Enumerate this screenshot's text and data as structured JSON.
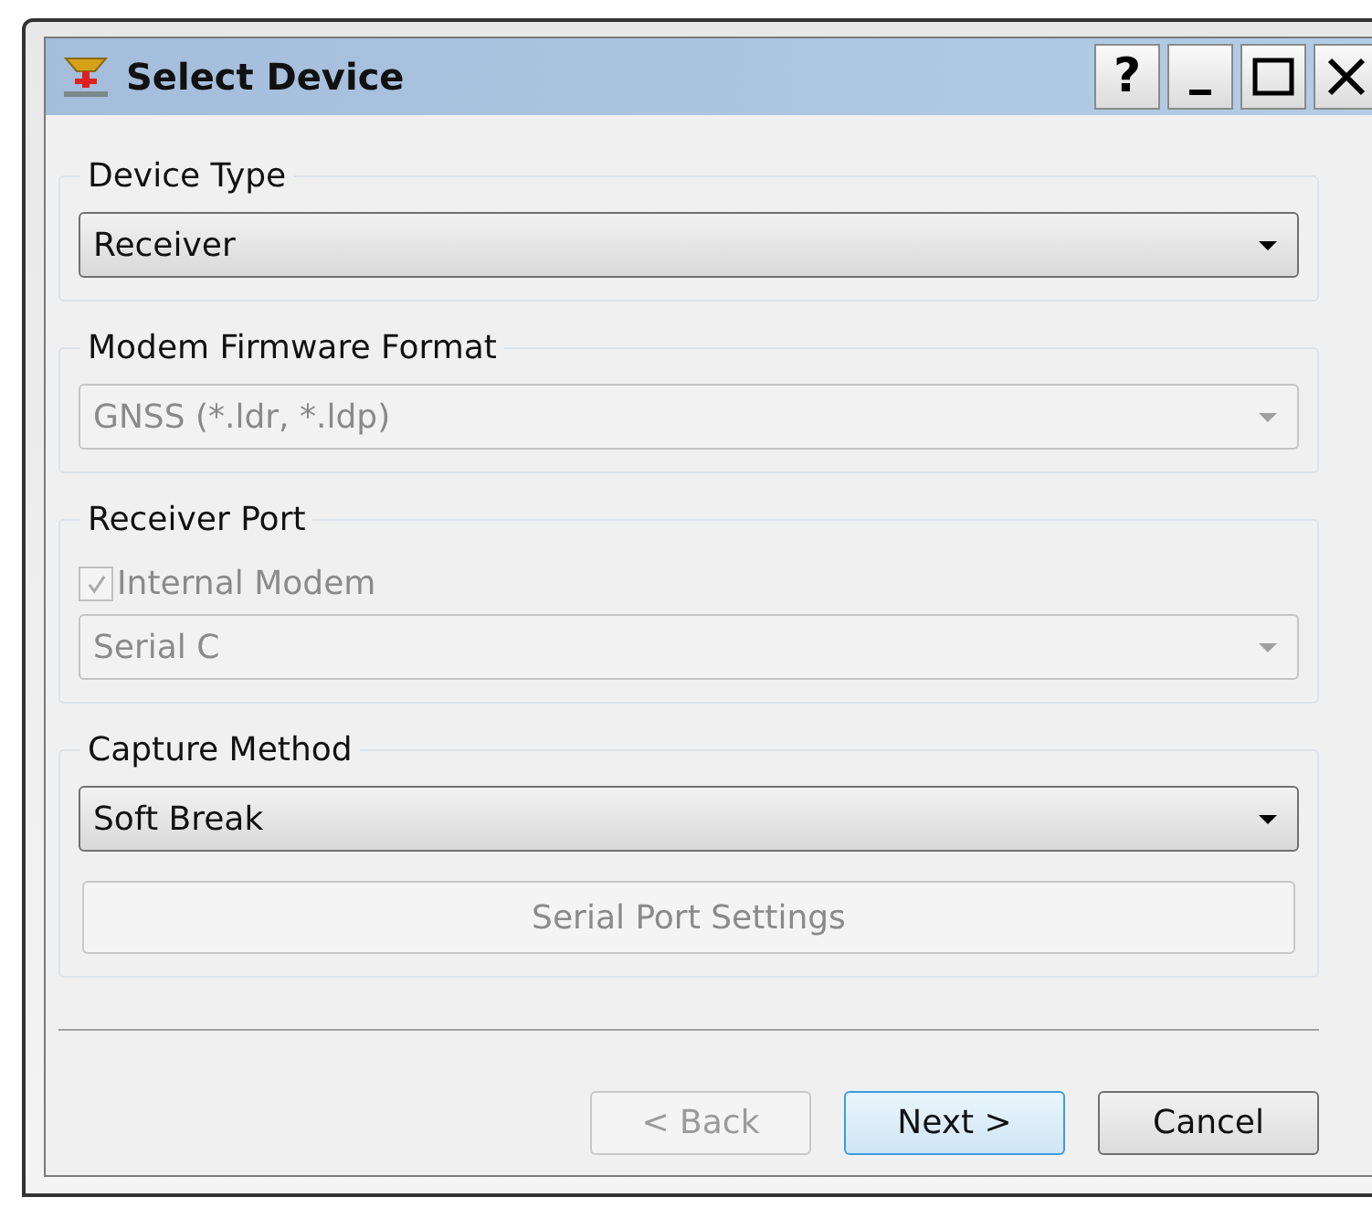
{
  "window": {
    "title": "Select Device",
    "controls": [
      {
        "kind": "help",
        "label": "?"
      },
      {
        "kind": "minimize"
      },
      {
        "kind": "maximize"
      },
      {
        "kind": "close"
      }
    ]
  },
  "groups": [
    {
      "title": "Device Type",
      "items": [
        {
          "kind": "combo",
          "value": "Receiver",
          "disabled": false
        }
      ]
    },
    {
      "title": "Modem Firmware Format",
      "items": [
        {
          "kind": "combo",
          "value": "GNSS (*.ldr, *.ldp)",
          "disabled": true
        }
      ]
    },
    {
      "title": "Receiver Port",
      "items": [
        {
          "kind": "checkbox",
          "label": "Internal Modem",
          "checked": true,
          "disabled": true
        },
        {
          "kind": "combo",
          "value": "Serial C",
          "disabled": true
        }
      ]
    },
    {
      "title": "Capture Method",
      "items": [
        {
          "kind": "combo",
          "value": "Soft Break",
          "disabled": false
        },
        {
          "kind": "button",
          "label": "Serial Port Settings",
          "disabled": true
        }
      ]
    }
  ],
  "buttons": [
    {
      "label": "< Back",
      "disabled": true,
      "default": false
    },
    {
      "label": "Next >",
      "disabled": false,
      "default": true
    },
    {
      "label": "Cancel",
      "disabled": false,
      "default": false
    }
  ]
}
